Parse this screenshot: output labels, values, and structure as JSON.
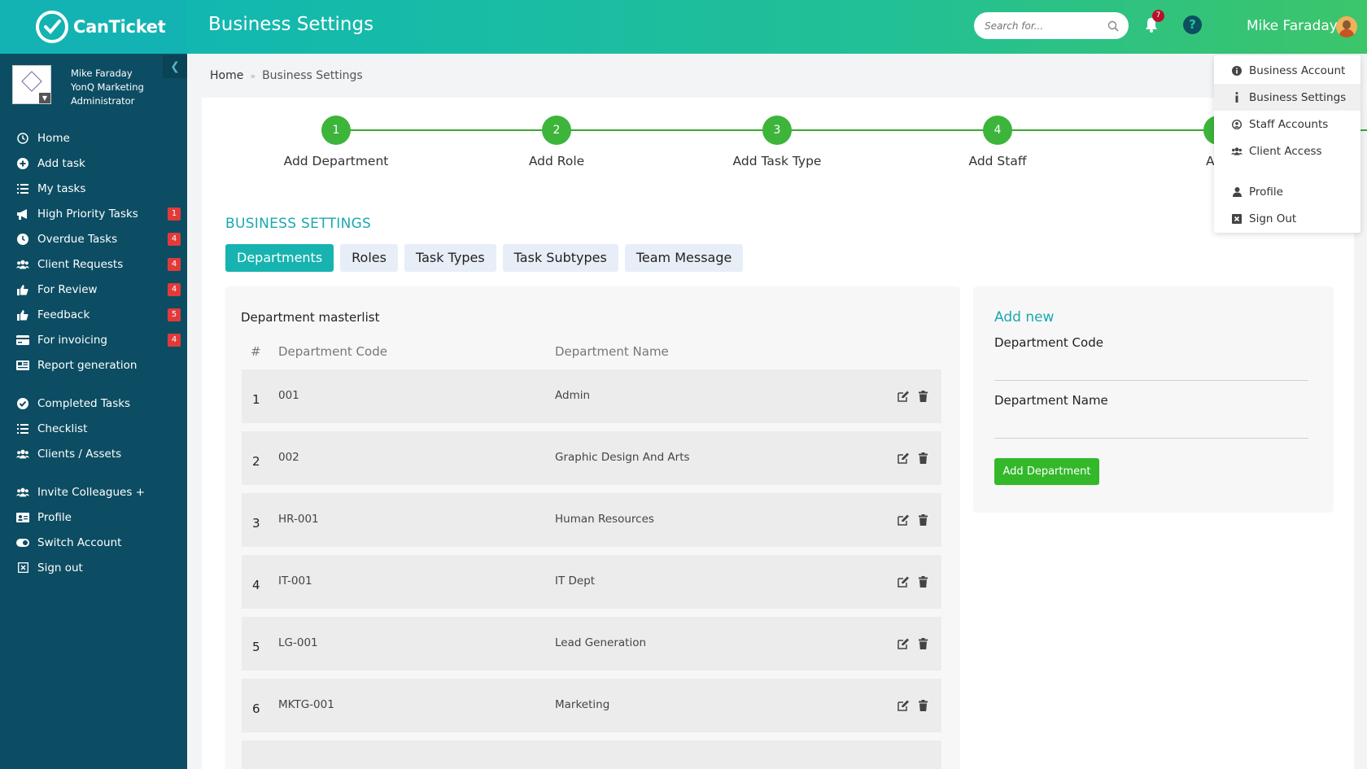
{
  "app": {
    "name": "CanTicket"
  },
  "sidebar": {
    "user": {
      "name": "Mike Faraday",
      "company": "YonQ Marketing",
      "role": "Administrator"
    },
    "items": [
      {
        "label": "Home",
        "icon": "clock-icon",
        "badge": ""
      },
      {
        "label": "Add task",
        "icon": "plus-circle-icon",
        "badge": ""
      },
      {
        "label": "My tasks",
        "icon": "list-icon",
        "badge": ""
      },
      {
        "label": "High Priority Tasks",
        "icon": "megaphone-icon",
        "badge": "1"
      },
      {
        "label": "Overdue Tasks",
        "icon": "clock-icon",
        "badge": "4"
      },
      {
        "label": "Client Requests",
        "icon": "users-icon",
        "badge": "4"
      },
      {
        "label": "For Review",
        "icon": "thumbs-up-icon",
        "badge": "4"
      },
      {
        "label": "Feedback",
        "icon": "thumbs-up-icon",
        "badge": "5"
      },
      {
        "label": "For invoicing",
        "icon": "credit-card-icon",
        "badge": "4"
      },
      {
        "label": "Report generation",
        "icon": "newspaper-icon",
        "badge": ""
      },
      {
        "label": "Completed Tasks",
        "icon": "check-circle-icon",
        "badge": ""
      },
      {
        "label": "Checklist",
        "icon": "list-icon",
        "badge": ""
      },
      {
        "label": "Clients / Assets",
        "icon": "users-icon",
        "badge": ""
      },
      {
        "label": "Invite Colleagues +",
        "icon": "users-icon",
        "badge": ""
      },
      {
        "label": "Profile",
        "icon": "id-card-icon",
        "badge": ""
      },
      {
        "label": "Switch Account",
        "icon": "toggle-icon",
        "badge": ""
      },
      {
        "label": "Sign out",
        "icon": "close-box-icon",
        "badge": ""
      }
    ]
  },
  "header": {
    "title": "Business Settings",
    "search_placeholder": "Search for...",
    "notifications_count": "7",
    "user_name": "Mike Faraday"
  },
  "breadcrumb": {
    "home": "Home",
    "current": "Business Settings"
  },
  "stepper": [
    {
      "num": "1",
      "label": "Add Department"
    },
    {
      "num": "2",
      "label": "Add Role"
    },
    {
      "num": "3",
      "label": "Add Task Type"
    },
    {
      "num": "4",
      "label": "Add Staff"
    },
    {
      "num": "",
      "label": "Add"
    }
  ],
  "section_title": "BUSINESS SETTINGS",
  "tabs": [
    "Departments",
    "Roles",
    "Task Types",
    "Task Subtypes",
    "Team Message"
  ],
  "masterlist": {
    "title": "Department masterlist",
    "columns": [
      "#",
      "Department Code",
      "Department Name"
    ],
    "rows": [
      {
        "num": "1",
        "code": "001",
        "name": "Admin"
      },
      {
        "num": "2",
        "code": "002",
        "name": "Graphic Design And Arts"
      },
      {
        "num": "3",
        "code": "HR-001",
        "name": "Human Resources"
      },
      {
        "num": "4",
        "code": "IT-001",
        "name": "IT Dept"
      },
      {
        "num": "5",
        "code": "LG-001",
        "name": "Lead Generation"
      },
      {
        "num": "6",
        "code": "MKTG-001",
        "name": "Marketing"
      },
      {
        "num": "",
        "code": "",
        "name": ""
      }
    ]
  },
  "addnew": {
    "title": "Add new",
    "code_label": "Department Code",
    "name_label": "Department Name",
    "code_value": "",
    "name_value": "",
    "button": "Add Department"
  },
  "dropdown": [
    {
      "label": "Business Account",
      "icon": "info-circle-icon"
    },
    {
      "label": "Business Settings",
      "icon": "info-icon"
    },
    {
      "label": "Staff Accounts",
      "icon": "user-circle-icon"
    },
    {
      "label": "Client Access",
      "icon": "users-icon"
    },
    {
      "label": "Profile",
      "icon": "user-icon"
    },
    {
      "label": "Sign Out",
      "icon": "close-box-icon"
    }
  ],
  "colors": {
    "brand_teal": "#17b3b0",
    "sidebar": "#0c4d63",
    "step_green": "#3db43a",
    "badge_red": "#e23a3a",
    "button_green": "#33b82a"
  }
}
